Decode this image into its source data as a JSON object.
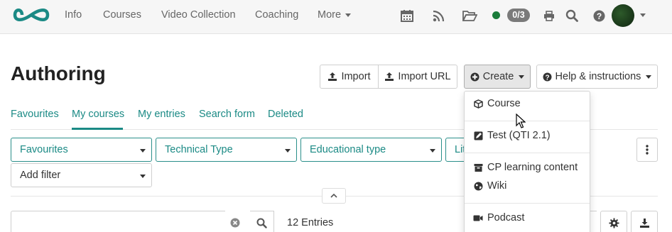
{
  "navbar": {
    "links": [
      "Info",
      "Courses",
      "Video Collection",
      "Coaching",
      "More"
    ],
    "icons": [
      "calendar-icon",
      "rss-icon",
      "folder-icon",
      "print-icon",
      "search-icon",
      "help-icon"
    ],
    "status_count": "0/3",
    "status_color": "#1a7c3a",
    "brand_color": "#1b8a85"
  },
  "header": {
    "title": "Authoring",
    "buttons": {
      "import": "Import",
      "import_url": "Import URL",
      "create": "Create",
      "help": "Help & instructions"
    }
  },
  "tabs": [
    "Favourites",
    "My courses",
    "My entries",
    "Search form",
    "Deleted"
  ],
  "active_tab": "My courses",
  "filters": {
    "items": [
      "Favourites",
      "Technical Type",
      "Educational type",
      "Lit"
    ],
    "add_filter": "Add filter"
  },
  "search": {
    "value": "",
    "entries_label": "12 Entries"
  },
  "create_menu": {
    "items": [
      {
        "label": "Course",
        "icon": "cube-icon"
      },
      {
        "label": "Test (QTI 2.1)",
        "icon": "test-icon"
      },
      {
        "label": "CP learning content",
        "icon": "archive-icon"
      },
      {
        "label": "Wiki",
        "icon": "globe-icon"
      },
      {
        "label": "Podcast",
        "icon": "video-icon"
      }
    ]
  }
}
